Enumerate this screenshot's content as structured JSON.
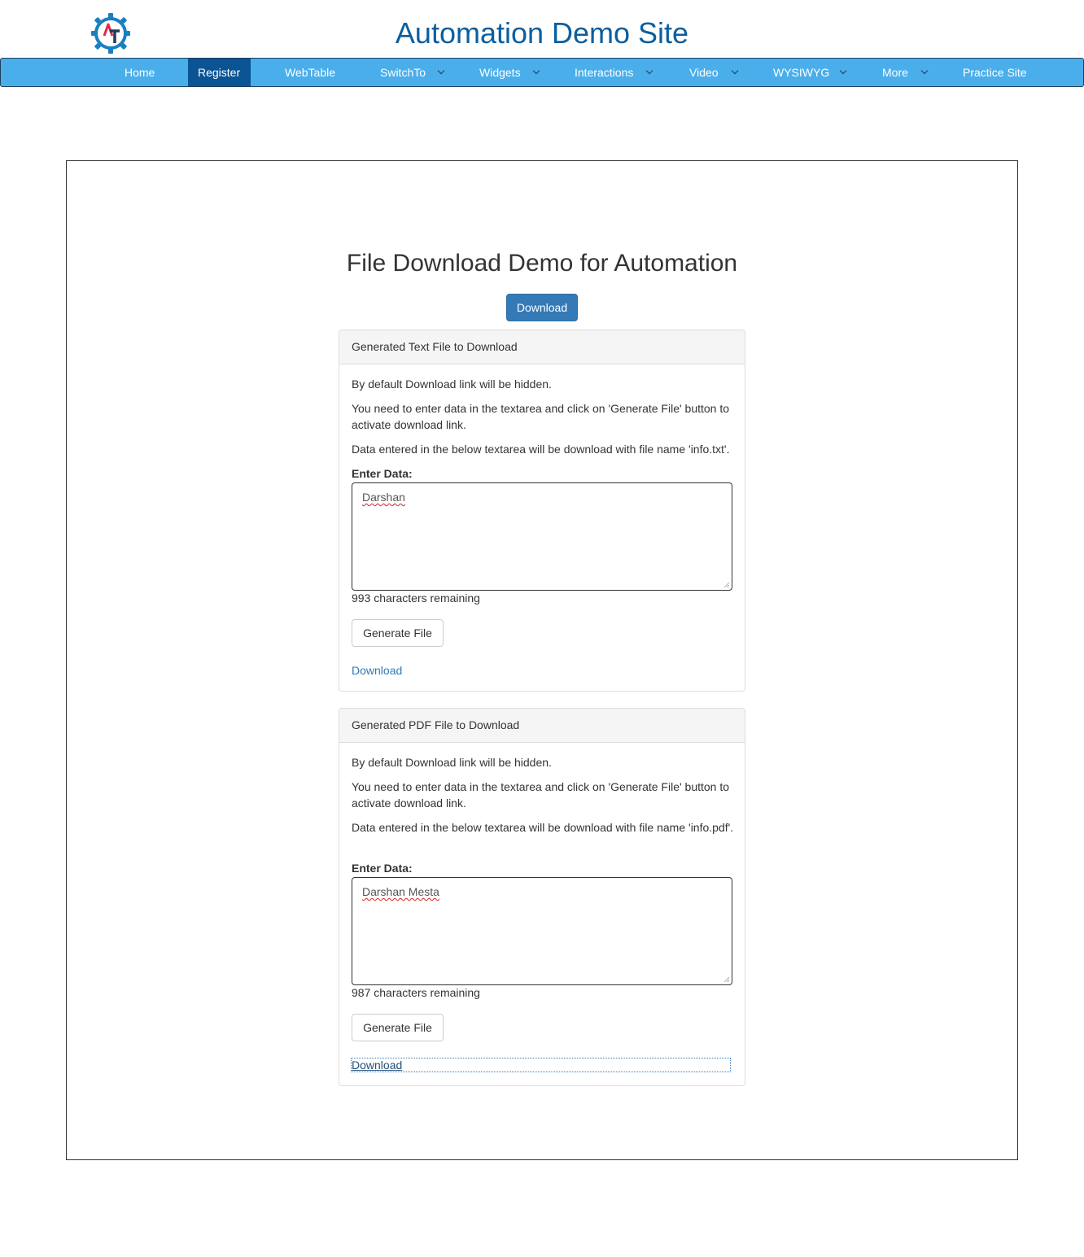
{
  "header": {
    "site_title": "Automation Demo Site",
    "logo_icon": "gear-at-logo-icon",
    "brand_colors": {
      "gear": "#1a7fc0",
      "a": "#e0294a",
      "t": "#1c3d5a"
    }
  },
  "nav": {
    "background": "#4aaeeb",
    "active_background": "#0b5494",
    "items": [
      {
        "label": "Home",
        "dropdown": false
      },
      {
        "label": "Register",
        "dropdown": false,
        "active": true
      },
      {
        "label": "WebTable",
        "dropdown": false
      },
      {
        "label": "SwitchTo",
        "dropdown": true
      },
      {
        "label": "Widgets",
        "dropdown": true
      },
      {
        "label": "Interactions",
        "dropdown": true
      },
      {
        "label": "Video",
        "dropdown": true
      },
      {
        "label": "WYSIWYG",
        "dropdown": true
      },
      {
        "label": "More",
        "dropdown": true
      },
      {
        "label": "Practice Site",
        "dropdown": false
      }
    ]
  },
  "main": {
    "title": "File Download Demo for Automation",
    "download_button": "Download",
    "text_panel": {
      "heading": "Generated Text File to Download",
      "p1": "By default Download link will be hidden.",
      "p2": "You need to enter data in the textarea and click on 'Generate File' button to activate download link.",
      "p3": "Data entered in the below textarea will be download with file name 'info.txt'.",
      "label": "Enter Data:",
      "textarea_value": "Darshan",
      "counter": "993 characters remaining",
      "generate_button": "Generate File",
      "download_link": "Download"
    },
    "pdf_panel": {
      "heading": "Generated PDF File to Download",
      "p1": "By default Download link will be hidden.",
      "p2": "You need to enter data in the textarea and click on 'Generate File' button to activate download link.",
      "p3": "Data entered in the below textarea will be download with file name 'info.pdf'.",
      "label": "Enter Data:",
      "textarea_value": "Darshan Mesta",
      "counter": "987 characters remaining",
      "generate_button": "Generate File",
      "download_link": "Download"
    }
  }
}
